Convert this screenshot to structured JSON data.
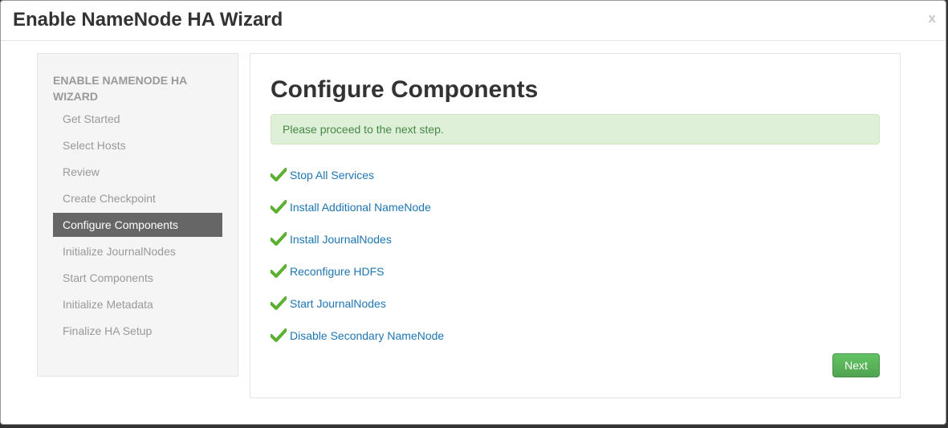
{
  "modal": {
    "title": "Enable NameNode HA Wizard",
    "close_label": "x"
  },
  "sidebar": {
    "header": "ENABLE NAMENODE HA WIZARD",
    "steps": [
      {
        "label": "Get Started",
        "active": false
      },
      {
        "label": "Select Hosts",
        "active": false
      },
      {
        "label": "Review",
        "active": false
      },
      {
        "label": "Create Checkpoint",
        "active": false
      },
      {
        "label": "Configure Components",
        "active": true
      },
      {
        "label": "Initialize JournalNodes",
        "active": false
      },
      {
        "label": "Start Components",
        "active": false
      },
      {
        "label": "Initialize Metadata",
        "active": false
      },
      {
        "label": "Finalize HA Setup",
        "active": false
      }
    ]
  },
  "main": {
    "title": "Configure Components",
    "alert": "Please proceed to the next step.",
    "tasks": [
      {
        "label": "Stop All Services",
        "status": "done",
        "icon": "check-icon"
      },
      {
        "label": "Install Additional NameNode",
        "status": "done",
        "icon": "check-icon"
      },
      {
        "label": "Install JournalNodes",
        "status": "done",
        "icon": "check-icon"
      },
      {
        "label": "Reconfigure HDFS",
        "status": "done",
        "icon": "check-icon"
      },
      {
        "label": "Start JournalNodes",
        "status": "done",
        "icon": "check-icon"
      },
      {
        "label": "Disable Secondary NameNode",
        "status": "done",
        "icon": "check-icon"
      }
    ],
    "next_label": "Next"
  },
  "colors": {
    "active_step_bg": "#666666",
    "success_alert_bg": "#dff0d8",
    "check_green": "#5bb02f",
    "link_blue": "#1e75b3",
    "next_button": "#51a351"
  }
}
